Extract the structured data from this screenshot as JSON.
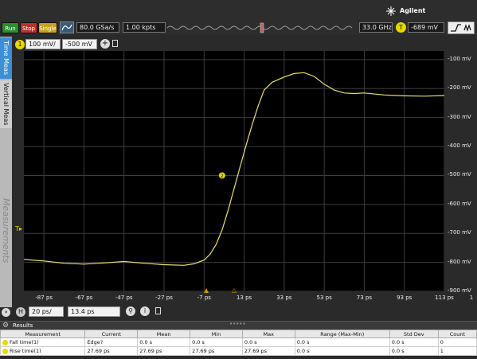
{
  "toolbar": {
    "run_label": "Run",
    "stop_label": "Stop",
    "single_label": "Single",
    "sample_rate": "80.0 GSa/s",
    "memory_depth": "1.00 kpts",
    "bandwidth": "33.0 GHz",
    "trigger_channel": "T",
    "trigger_level": "-689 mV",
    "brand": "Agilent"
  },
  "channel": {
    "number": "1",
    "scale": "100 mV/",
    "offset": "-500 mV"
  },
  "side_tabs": {
    "time_meas": "Time Meas",
    "vertical_meas": "Vertical Meas",
    "measurements_watermark": "Measurements"
  },
  "y_ticks": [
    "-100 mV",
    "-200 mV",
    "-300 mV",
    "-400 mV",
    "-500 mV",
    "-600 mV",
    "-700 mV",
    "-800 mV",
    "-900 mV"
  ],
  "x_ticks": [
    "-87 ps",
    "-67 ps",
    "-47 ps",
    "-27 ps",
    "-7 ps",
    "13 ps",
    "33 ps",
    "53 ps",
    "73 ps",
    "93 ps",
    "113 ps"
  ],
  "x_tick_end": "1",
  "markers": {
    "trigger_marker": "T",
    "measurement_marker": "2"
  },
  "horizontal": {
    "label": "H",
    "scale": "20 ps/",
    "position": "13.4 ps"
  },
  "results": {
    "title": "Results",
    "columns": [
      "Measurement",
      "Current",
      "Mean",
      "Min",
      "Max",
      "Range (Max-Min)",
      "Std Dev",
      "Count"
    ],
    "rows": [
      [
        "Fall time(1)",
        "Edge?",
        "0.0 s",
        "0.0 s",
        "0.0 s",
        "0.0 s",
        "0.0 s",
        "0"
      ],
      [
        "Rise time(1)",
        "27.69 ps",
        "27.69 ps",
        "27.69 ps",
        "27.69 ps",
        "0.0 s",
        "0.0 s",
        "1"
      ]
    ]
  },
  "chart_data": {
    "type": "line",
    "xlabel": "",
    "ylabel": "",
    "xlim": [
      -97,
      113
    ],
    "ylim": [
      -900,
      -70
    ],
    "x_unit": "ps",
    "y_unit": "mV",
    "grid": true,
    "series": [
      {
        "color": "#e8e070",
        "x": [
          -97,
          -87,
          -77,
          -67,
          -57,
          -47,
          -37,
          -27,
          -17,
          -12,
          -7,
          -4,
          -1,
          2,
          5,
          8,
          11,
          14,
          17,
          20,
          23,
          27,
          33,
          38,
          43,
          48,
          53,
          58,
          63,
          68,
          73,
          83,
          93,
          103,
          113
        ],
        "y": [
          -790,
          -795,
          -803,
          -806,
          -802,
          -797,
          -803,
          -808,
          -810,
          -805,
          -792,
          -772,
          -738,
          -688,
          -620,
          -545,
          -470,
          -395,
          -325,
          -260,
          -205,
          -178,
          -160,
          -148,
          -145,
          -158,
          -185,
          -205,
          -215,
          -217,
          -215,
          -222,
          -225,
          -226,
          -224
        ]
      }
    ]
  },
  "colors": {
    "run": "#2e8b2e",
    "stop": "#c0302a",
    "single": "#c8a020",
    "trace": "#e8e070",
    "grid": "#3d3d3d",
    "channel_badge": "#e8d800"
  }
}
